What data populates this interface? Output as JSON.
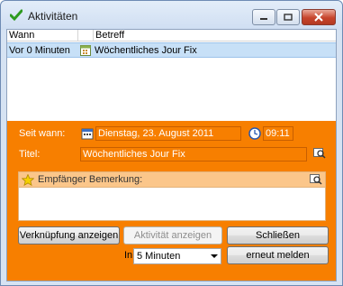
{
  "window": {
    "title": "Aktivitäten"
  },
  "list": {
    "columns": [
      "Wann",
      "Betreff"
    ],
    "rows": [
      {
        "wann": "Vor 0 Minuten",
        "betreff": "Wöchentliches Jour Fix"
      }
    ]
  },
  "form": {
    "seit_wann_label": "Seit wann:",
    "date_value": "Dienstag, 23. August 2011",
    "time_value": "09:11",
    "titel_label": "Titel:",
    "titel_value": "Wöchentliches Jour Fix",
    "bemerkung_label": "Empfänger Bemerkung:",
    "bemerkung_value": ""
  },
  "buttons": {
    "verknuepfung": "Verknüpfung anzeigen",
    "aktivitaet": "Aktivität anzeigen",
    "schliessen": "Schließen",
    "erneut_melden": "erneut melden"
  },
  "snooze": {
    "in_label": "In",
    "selected": "5 Minuten"
  },
  "colors": {
    "accent": "#f77f00",
    "selection": "#c7e0f7"
  }
}
